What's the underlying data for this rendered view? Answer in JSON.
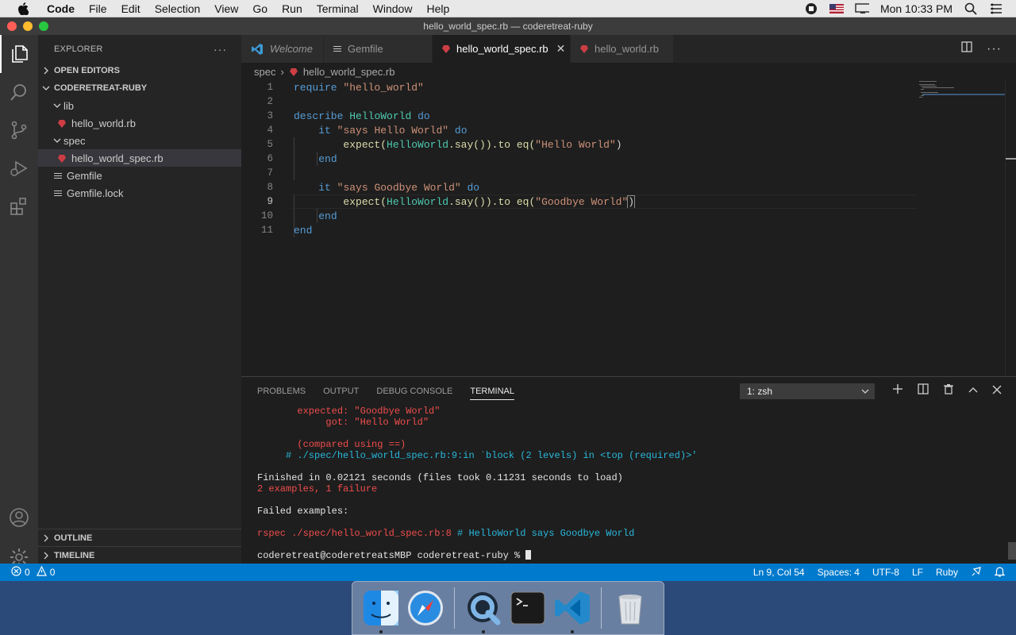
{
  "menubar": {
    "app_name": "Code",
    "items": [
      "File",
      "Edit",
      "Selection",
      "View",
      "Go",
      "Run",
      "Terminal",
      "Window",
      "Help"
    ],
    "clock": "Mon 10:33 PM"
  },
  "window": {
    "title": "hello_world_spec.rb — coderetreat-ruby"
  },
  "sidebar": {
    "title": "EXPLORER",
    "open_editors": "OPEN EDITORS",
    "project": "CODERETREAT-RUBY",
    "tree": {
      "lib": "lib",
      "lib_file": "hello_world.rb",
      "spec": "spec",
      "spec_file": "hello_world_spec.rb",
      "gemfile": "Gemfile",
      "gemfile_lock": "Gemfile.lock"
    },
    "outline": "OUTLINE",
    "timeline": "TIMELINE"
  },
  "tabs": {
    "welcome": "Welcome",
    "gemfile": "Gemfile",
    "spec": "hello_world_spec.rb",
    "hello": "hello_world.rb"
  },
  "breadcrumb": {
    "folder": "spec",
    "file": "hello_world_spec.rb"
  },
  "editor": {
    "line_numbers": [
      "1",
      "2",
      "3",
      "4",
      "5",
      "6",
      "7",
      "8",
      "9",
      "10",
      "11"
    ],
    "code": {
      "l1_kw": "require",
      "l1_str": "\"hello_world\"",
      "l3_kw": "describe",
      "l3_cls": "HelloWorld",
      "l3_do": "do",
      "l4_it": "it",
      "l4_str": "\"says Hello World\"",
      "l4_do": "do",
      "l5_expect": "expect(",
      "l5_cls": "HelloWorld",
      "l5_mid": ".say()).to eq(",
      "l5_str": "\"Hello World\"",
      "l5_end": ")",
      "l6_end": "end",
      "l8_it": "it",
      "l8_str": "\"says Goodbye World\"",
      "l8_do": "do",
      "l9_expect": "expect(",
      "l9_cls": "HelloWorld",
      "l9_mid": ".say()).to eq(",
      "l9_str": "\"Goodbye World\"",
      "l9_end": ")",
      "l10_end": "end",
      "l11_end": "end"
    }
  },
  "panel": {
    "tabs": [
      "PROBLEMS",
      "OUTPUT",
      "DEBUG CONSOLE",
      "TERMINAL"
    ],
    "terminal_select": "1: zsh",
    "terminal_lines": {
      "expected": "       expected: \"Goodbye World\"",
      "got": "            got: \"Hello World\"",
      "compared": "       (compared using ==)",
      "trace": "     # ./spec/hello_world_spec.rb:9:in `block (2 levels) in <top (required)>'",
      "finished": "Finished in 0.02121 seconds (files took 0.11231 seconds to load)",
      "summary": "2 examples, 1 failure",
      "failed": "Failed examples:",
      "rspec_cmd": "rspec ./spec/hello_world_spec.rb:8",
      "rspec_comment": " # HelloWorld says Goodbye World",
      "prompt": "coderetreat@coderetreatsMBP coderetreat-ruby % "
    }
  },
  "statusbar": {
    "errors": "0",
    "warnings": "0",
    "position": "Ln 9, Col 54",
    "spaces": "Spaces: 4",
    "encoding": "UTF-8",
    "eol": "LF",
    "language": "Ruby"
  },
  "colors": {
    "accent": "#007acc",
    "ruby": "#cc3e44",
    "error": "#f14c4c"
  }
}
